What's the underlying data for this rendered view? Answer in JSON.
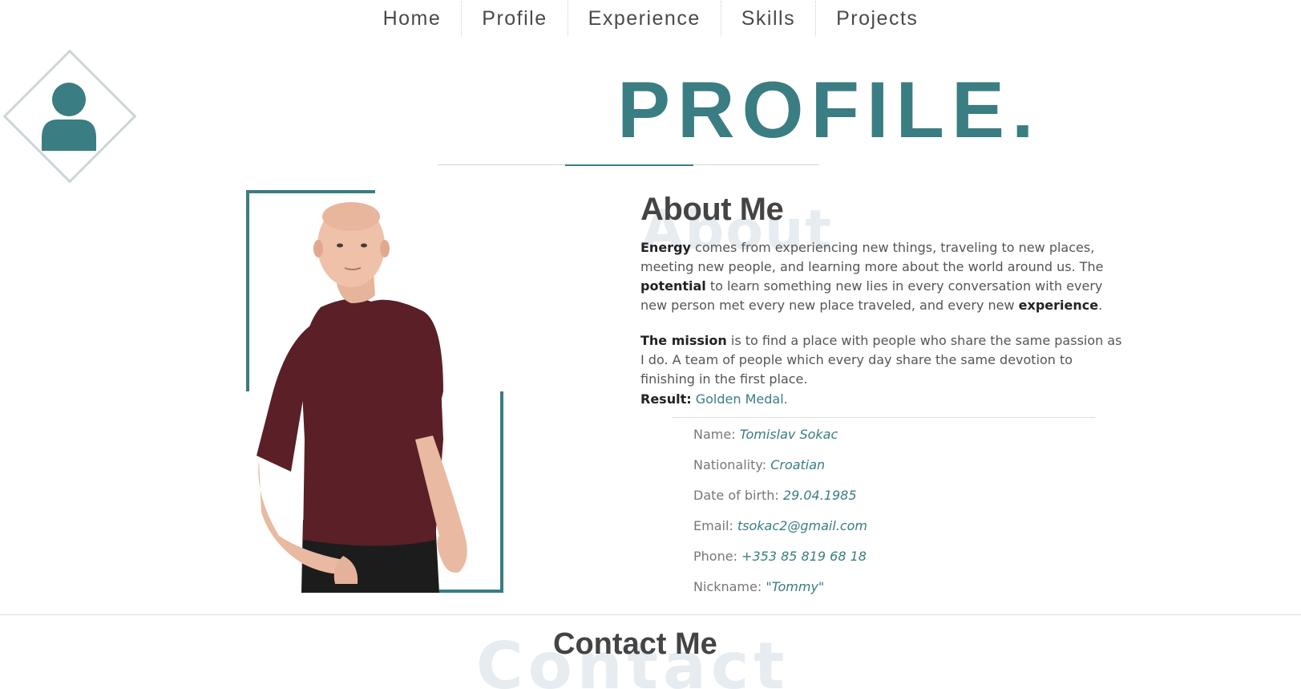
{
  "nav": {
    "items": [
      {
        "label": "Home"
      },
      {
        "label": "Profile"
      },
      {
        "label": "Experience"
      },
      {
        "label": "Skills"
      },
      {
        "label": "Projects"
      }
    ]
  },
  "header": {
    "title": "PROFILE.",
    "icon": "user-icon"
  },
  "about": {
    "heading": "About Me",
    "ghost": "About",
    "p1": {
      "energy": "Energy",
      "t1": " comes from experiencing new things, traveling to new places, meeting new people, and learning more about the world around us. The ",
      "potential": "potential",
      "t2": " to learn something new lies in every conversation with every new person met every new place traveled, and every new ",
      "experience": "experience",
      "t3": "."
    },
    "p2": {
      "mission": "The mission",
      "t1": " is to find a place with people who share the same passion as I do. A team of people which every day share the same devotion to finishing in the first place."
    },
    "result_label": "Result:",
    "result_value": "Golden Medal."
  },
  "info": [
    {
      "label": "Name:",
      "value": "Tomislav Sokac"
    },
    {
      "label": "Nationality:",
      "value": "Croatian"
    },
    {
      "label": "Date of birth:",
      "value": "29.04.1985"
    },
    {
      "label": "Email:",
      "value": "tsokac2@gmail.com"
    },
    {
      "label": "Phone:",
      "value": "+353 85 819 68 18"
    },
    {
      "label": "Nickname:",
      "value": "\"Tommy\""
    }
  ],
  "contact": {
    "heading": "Contact Me",
    "ghost": "Contact"
  },
  "colors": {
    "accent": "#3a7d82",
    "ghost": "#e6ecef",
    "shirt": "#5b1f27"
  }
}
